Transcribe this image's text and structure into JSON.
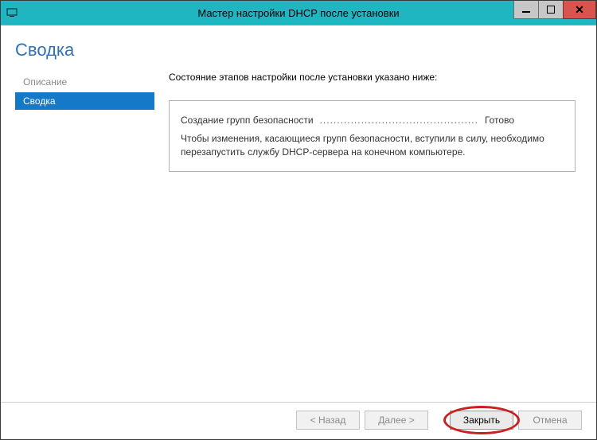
{
  "window": {
    "title": "Мастер настройки DHCP после установки"
  },
  "heading": "Сводка",
  "sidebar": {
    "items": [
      {
        "label": "Описание",
        "selected": false
      },
      {
        "label": "Сводка",
        "selected": true
      }
    ]
  },
  "main": {
    "intro": "Состояние этапов настройки после установки указано ниже:",
    "status": {
      "label": "Создание групп безопасности",
      "dots": "..............................................",
      "value": "Готово"
    },
    "note": "Чтобы изменения, касающиеся групп безопасности, вступили в силу, необходимо перезапустить службу DHCP-сервера на конечном компьютере."
  },
  "footer": {
    "back": "< Назад",
    "next": "Далее >",
    "close": "Закрыть",
    "cancel": "Отмена"
  }
}
